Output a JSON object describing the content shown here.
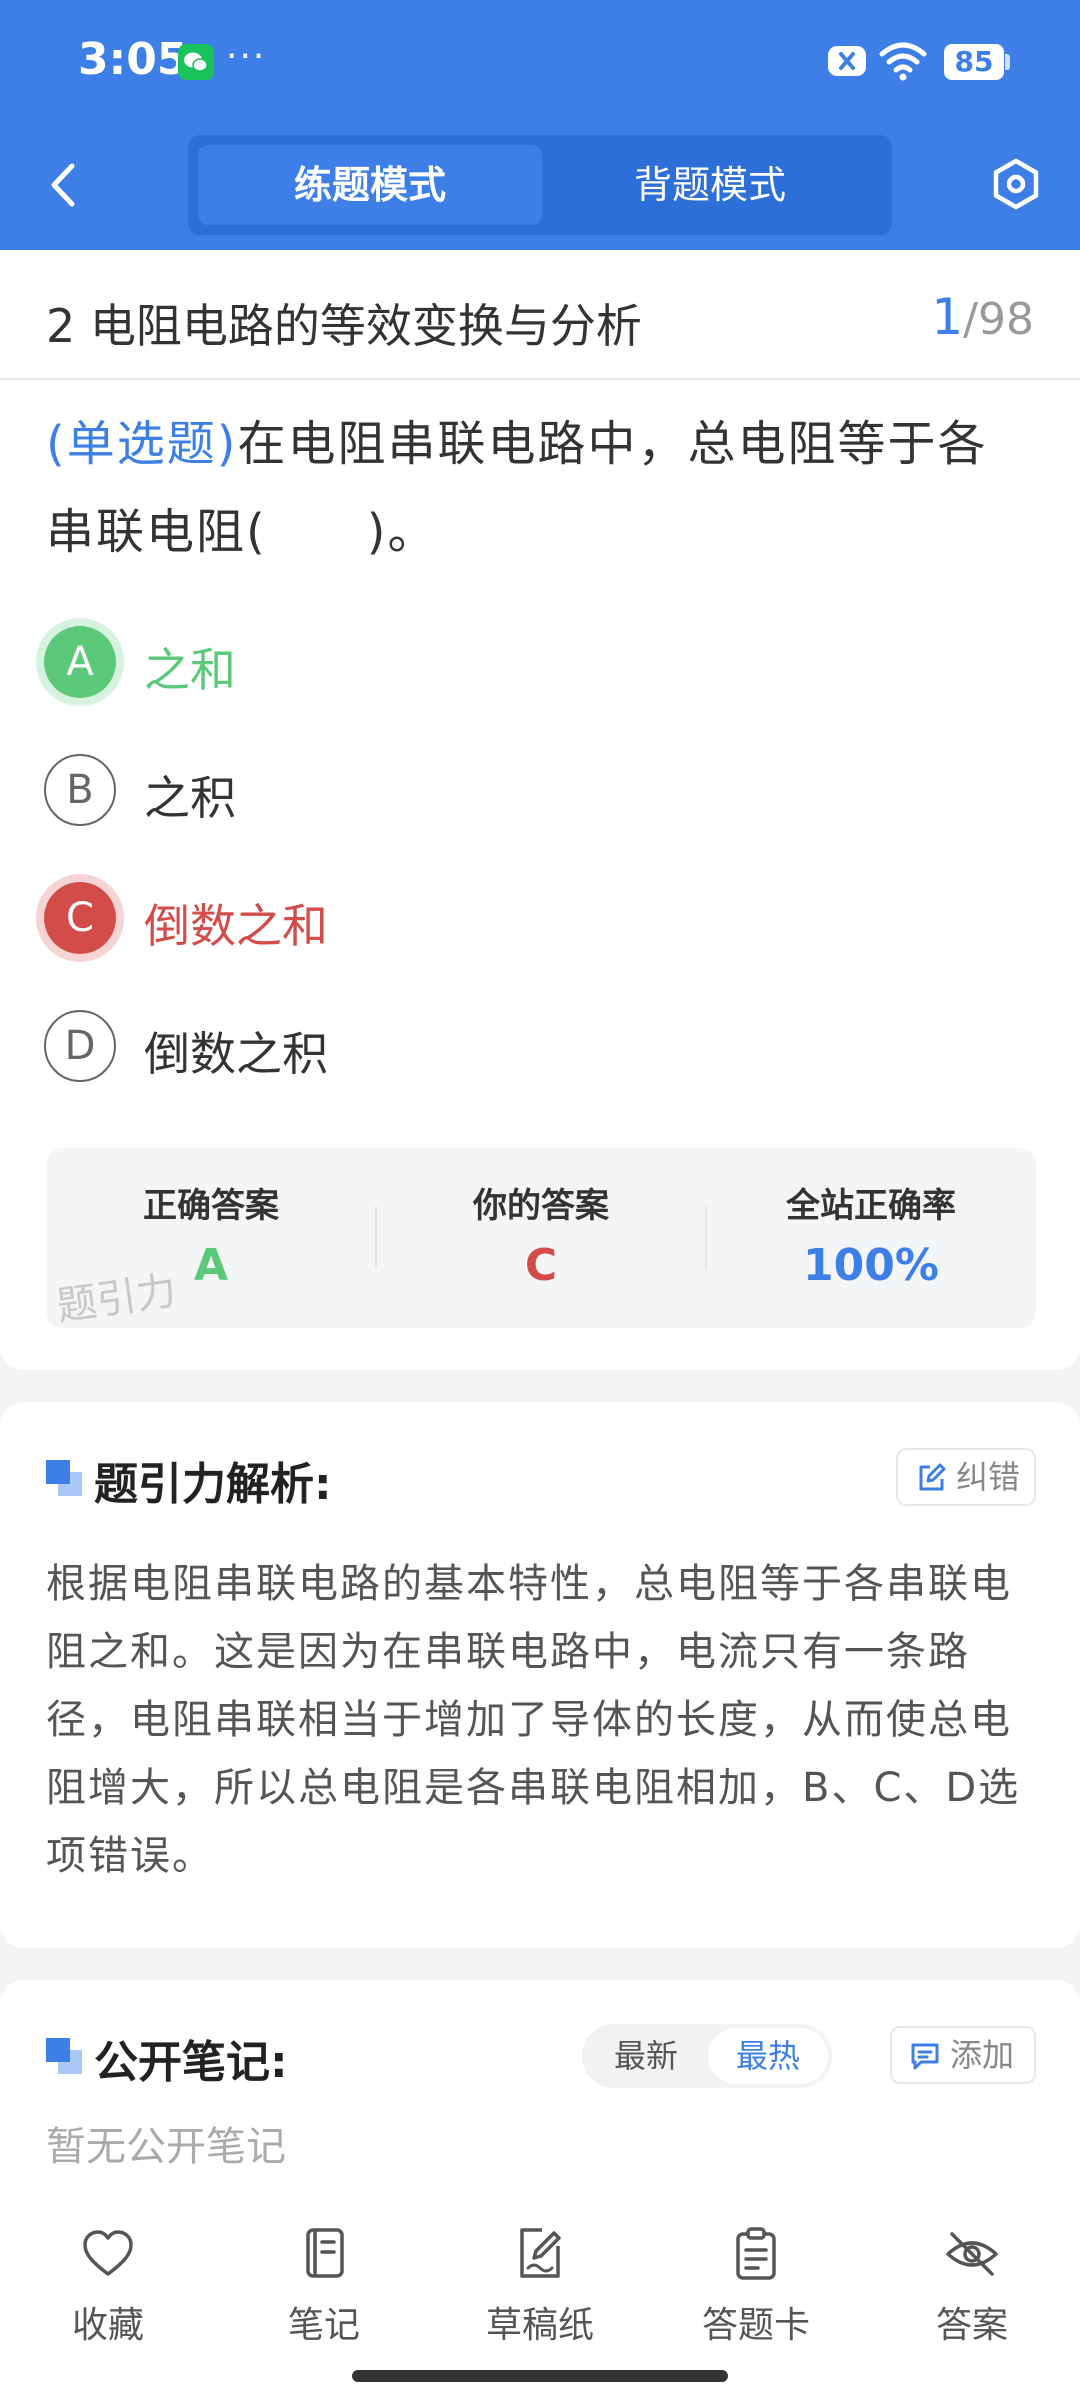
{
  "status_bar": {
    "time": "3:05",
    "more": "···",
    "battery": "85"
  },
  "header": {
    "modes": [
      {
        "label": "练题模式",
        "active": true
      },
      {
        "label": "背题模式",
        "active": false
      }
    ],
    "icons": {
      "back": "back-arrow-icon",
      "settings": "settings-hexagon-icon",
      "app": "wechat-icon"
    }
  },
  "title_bar": {
    "title": "2 电阻电路的等效变换与分析",
    "current": "1",
    "separator": "/",
    "total": "98"
  },
  "question": {
    "type": "(单选题)",
    "text": "在电阻串联电路中，总电阻等于各串联电阻(　　)。",
    "options": [
      {
        "letter": "A",
        "text": "之和",
        "state": "correct"
      },
      {
        "letter": "B",
        "text": "之积",
        "state": "normal"
      },
      {
        "letter": "C",
        "text": "倒数之和",
        "state": "wrong"
      },
      {
        "letter": "D",
        "text": "倒数之积",
        "state": "normal"
      }
    ]
  },
  "result": {
    "correct_label": "正确答案",
    "correct_value": "A",
    "yours_label": "你的答案",
    "yours_value": "C",
    "rate_label": "全站正确率",
    "rate_value": "100%",
    "watermark": "题引力"
  },
  "analysis": {
    "title": "题引力解析:",
    "report_label": "纠错",
    "text": "根据电阻串联电路的基本特性，总电阻等于各串联电阻之和。这是因为在串联电路中，电流只有一条路径，电阻串联相当于增加了导体的长度，从而使总电阻增大，所以总电阻是各串联电阻相加，B、C、D选项错误。"
  },
  "notes": {
    "title": "公开笔记:",
    "sort_options": [
      "最新",
      "最热"
    ],
    "sort_selected": "最热",
    "add_label": "添加",
    "empty_text": "暂无公开笔记"
  },
  "bottom_bar": [
    {
      "label": "收藏",
      "icon": "heart-icon"
    },
    {
      "label": "笔记",
      "icon": "notebook-icon"
    },
    {
      "label": "草稿纸",
      "icon": "draft-paper-icon"
    },
    {
      "label": "答题卡",
      "icon": "answer-sheet-icon"
    },
    {
      "label": "答案",
      "icon": "eye-off-icon"
    }
  ],
  "colors": {
    "primary": "#3d7fe6",
    "correct": "#5cc97a",
    "wrong": "#d24d4a",
    "background": "#f3f4f6"
  }
}
